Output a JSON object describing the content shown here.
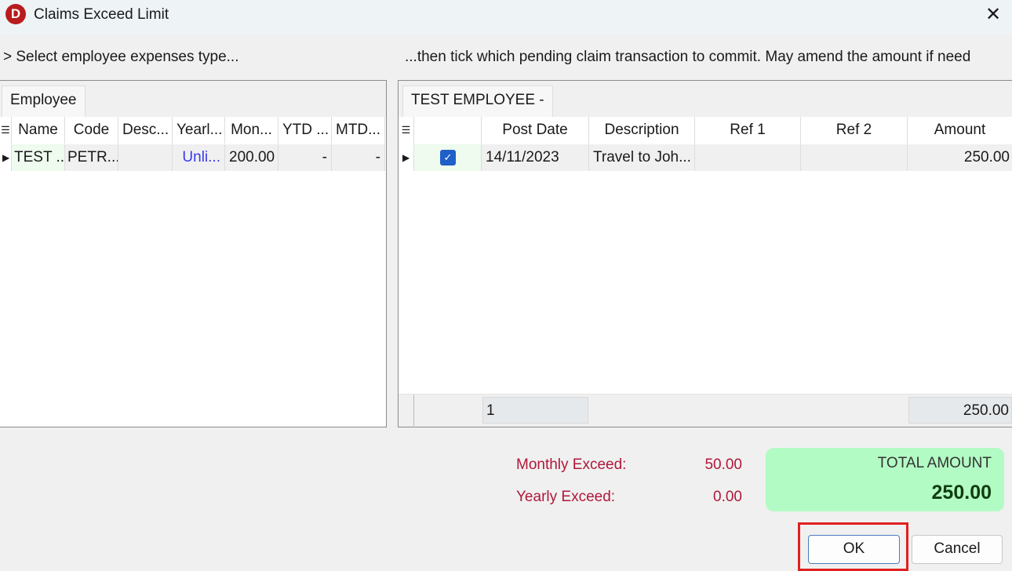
{
  "window": {
    "title": "Claims Exceed Limit",
    "close": "✕",
    "logo": "D"
  },
  "left": {
    "instruction": "> Select employee expenses type...",
    "tab": "Employee",
    "columns": [
      "Name",
      "Code",
      "Desc...",
      "Yearl...",
      "Mon...",
      "YTD ...",
      "MTD..."
    ],
    "rows": [
      [
        "TEST ...",
        "PETR...",
        "",
        "Unli...",
        "200.00",
        "-",
        "-"
      ]
    ]
  },
  "right": {
    "instruction": "...then tick which pending claim transaction to commit. May amend the amount if need",
    "tab": "TEST EMPLOYEE -",
    "columns": [
      "",
      "Post Date",
      "Description",
      "Ref 1",
      "Ref 2",
      "Amount"
    ],
    "rows": [
      {
        "checked": true,
        "post_date": "14/11/2023",
        "description": "Travel to Joh...",
        "ref1": "",
        "ref2": "",
        "amount": "250.00"
      }
    ],
    "footer": {
      "count": "1",
      "amount_total": "250.00"
    }
  },
  "summary": {
    "monthly_label": "Monthly Exceed:",
    "monthly_value": "50.00",
    "yearly_label": "Yearly Exceed:",
    "yearly_value": "0.00",
    "total_label": "TOTAL AMOUNT",
    "total_value": "250.00"
  },
  "buttons": {
    "ok": "OK",
    "cancel": "Cancel"
  },
  "colors": {
    "total_bg": "#b3fbc4",
    "highlight": "#e02020",
    "link": "#3a3af0",
    "label": "#b0173a"
  }
}
